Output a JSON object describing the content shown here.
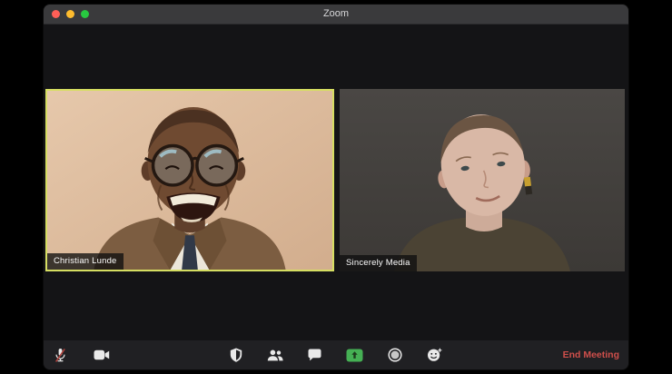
{
  "window": {
    "title": "Zoom"
  },
  "titlebar": {
    "traffic_lights": [
      {
        "name": "close",
        "color": "#ff5f57"
      },
      {
        "name": "minimize",
        "color": "#febc2e"
      },
      {
        "name": "zoom",
        "color": "#28c840"
      }
    ]
  },
  "meeting": {
    "participants": [
      {
        "name": "Christian Lunde",
        "active_speaker": true
      },
      {
        "name": "Sincerely Media",
        "active_speaker": false
      }
    ],
    "active_speaker_border_color": "#d6de62"
  },
  "toolbar": {
    "buttons": [
      {
        "icon": "microphone-muted-icon"
      },
      {
        "icon": "video-camera-icon"
      },
      {
        "icon": "security-shield-icon"
      },
      {
        "icon": "participants-icon"
      },
      {
        "icon": "chat-bubble-icon"
      },
      {
        "icon": "share-screen-icon",
        "color": "#45b054"
      },
      {
        "icon": "record-icon"
      },
      {
        "icon": "reactions-smiley-icon"
      }
    ],
    "end_meeting_label": "End Meeting",
    "end_meeting_color": "#cf4f4b"
  }
}
